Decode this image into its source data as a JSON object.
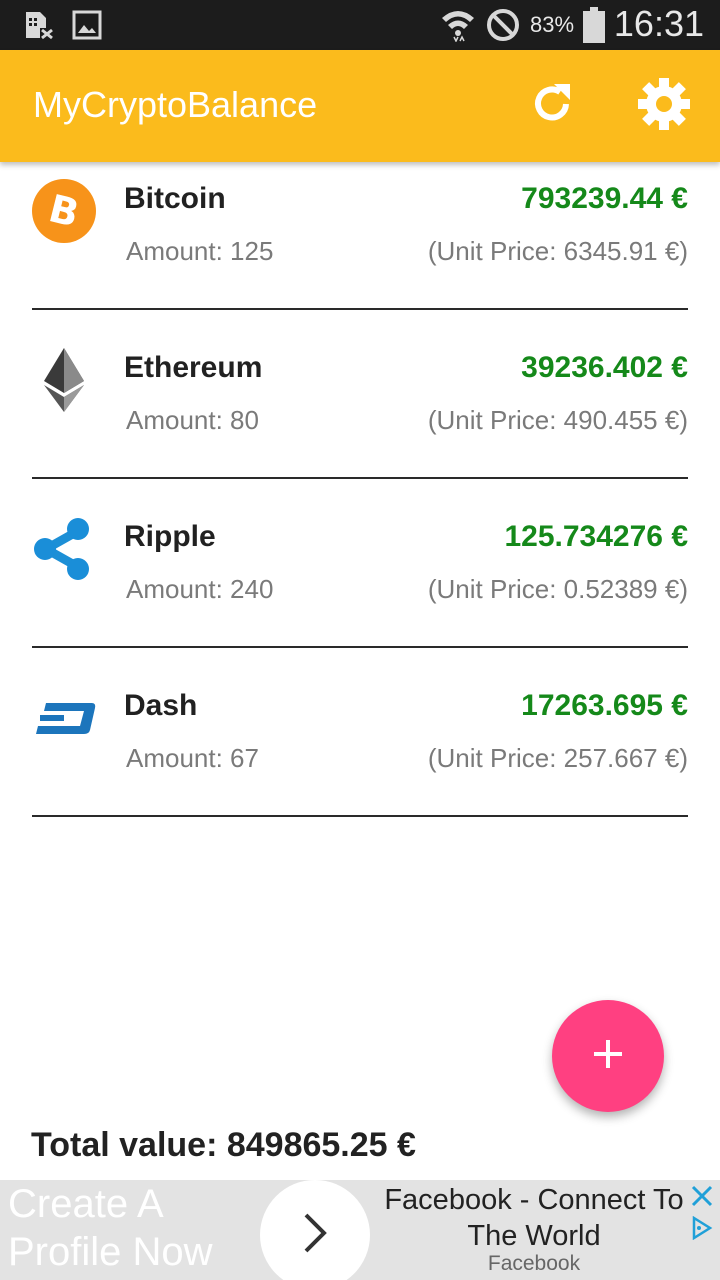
{
  "status_bar": {
    "battery": "83%",
    "time": "16:31",
    "left_icons": [
      "sim-error-icon",
      "image-icon"
    ],
    "right_icons": [
      "wifi-icon",
      "do-not-disturb-icon",
      "battery-icon"
    ]
  },
  "app_bar": {
    "title": "MyCryptoBalance",
    "actions": [
      "refresh-icon",
      "settings-gear-icon"
    ],
    "color": "#fbbb1c"
  },
  "coins": [
    {
      "name": "Bitcoin",
      "amount": "Amount: 125",
      "value": "793239.44 €",
      "unit_price": "(Unit Price: 6345.91 €)",
      "icon": "bitcoin-icon"
    },
    {
      "name": "Ethereum",
      "amount": "Amount: 80",
      "value": "39236.402 €",
      "unit_price": "(Unit Price: 490.455 €)",
      "icon": "ethereum-icon"
    },
    {
      "name": "Ripple",
      "amount": "Amount: 240",
      "value": "125.734276 €",
      "unit_price": "(Unit Price: 0.52389 €)",
      "icon": "ripple-icon"
    },
    {
      "name": "Dash",
      "amount": "Amount: 67",
      "value": "17263.695 €",
      "unit_price": "(Unit Price: 257.667 €)",
      "icon": "dash-icon"
    }
  ],
  "total": "Total value: 849865.25 €",
  "fab": {
    "icon": "plus-icon",
    "color": "#ff4081"
  },
  "ad": {
    "left_text": "Create A Profile Now",
    "title": "Facebook - Connect To The World",
    "brand": "Facebook",
    "icons": [
      "chevron-right-icon",
      "ad-close-icon",
      "adchoices-icon"
    ]
  },
  "colors": {
    "value_green": "#15891a",
    "divider": "#2a2a2a"
  }
}
